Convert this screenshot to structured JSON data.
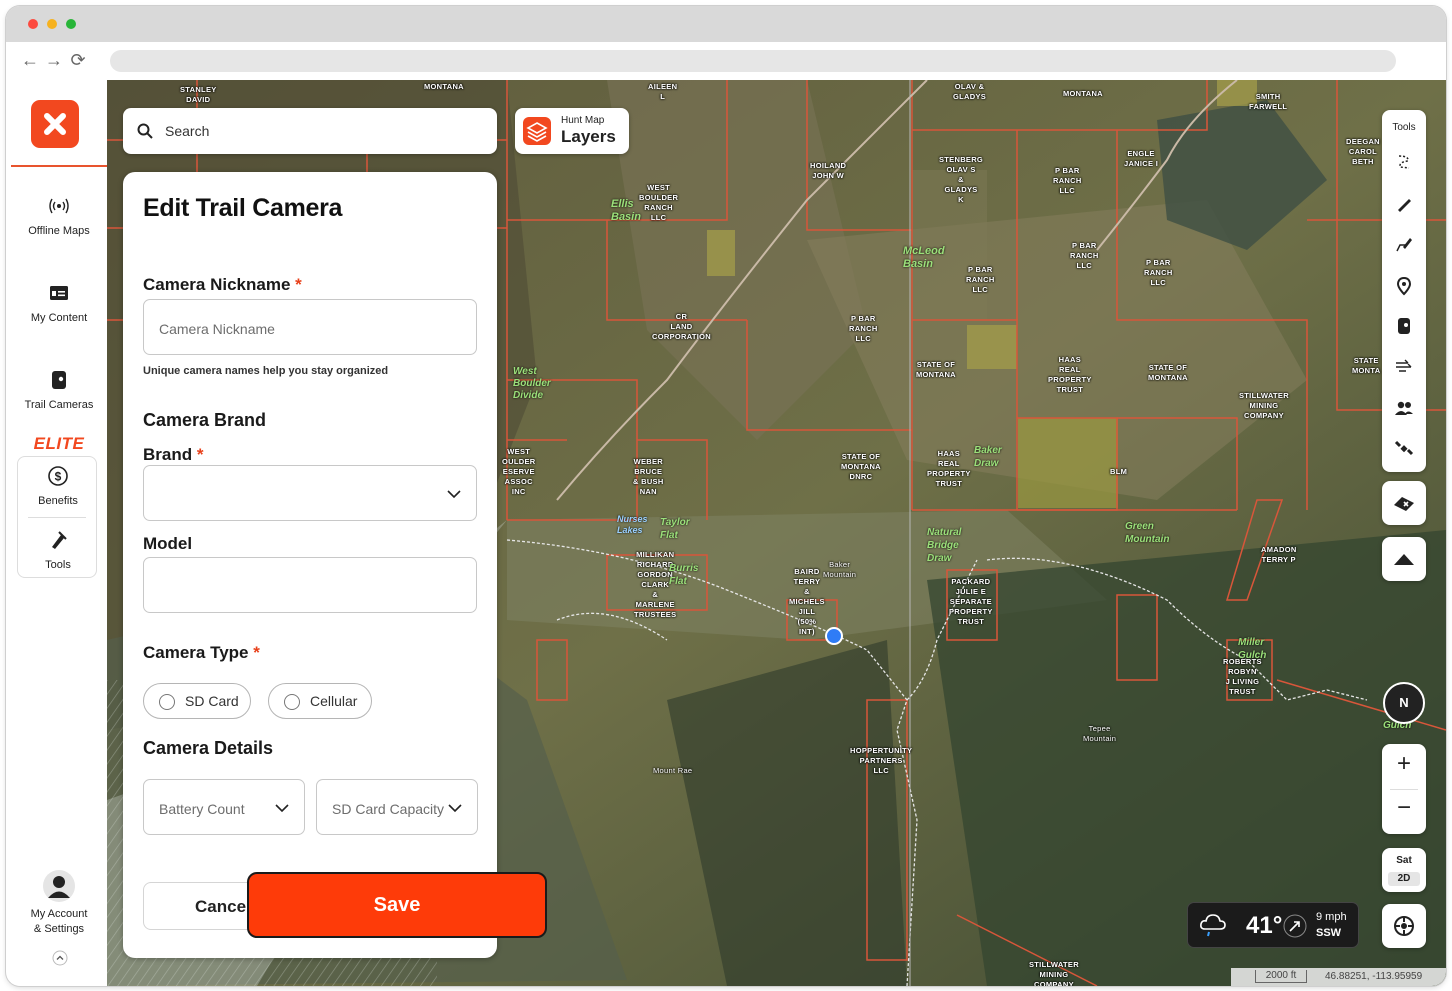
{
  "browser": {
    "back": "←",
    "forward": "→",
    "reload": "⟳"
  },
  "sidebar": {
    "items": [
      {
        "label": "Offline Maps",
        "icon": "offline-maps-icon"
      },
      {
        "label": "My Content",
        "icon": "my-content-icon"
      },
      {
        "label": "Trail Cameras",
        "icon": "trail-camera-icon"
      }
    ],
    "elite": "ELITE",
    "elite_items": [
      {
        "label": "Benefits",
        "icon": "dollar-icon"
      },
      {
        "label": "Tools",
        "icon": "tools-icon"
      }
    ],
    "account_line1": "My Account",
    "account_line2": "& Settings"
  },
  "search": {
    "placeholder": "Search"
  },
  "layers": {
    "small": "Hunt Map",
    "large": "Layers"
  },
  "form": {
    "title": "Edit Trail Camera",
    "nickname_label": "Camera Nickname",
    "required_mark": "*",
    "nickname_placeholder": "Camera Nickname",
    "nickname_hint": "Unique camera names help you stay organized",
    "brand_section": "Camera Brand",
    "brand_label": "Brand",
    "model_label": "Model",
    "type_label": "Camera Type",
    "type_options": [
      "SD Card",
      "Cellular"
    ],
    "details_section": "Camera Details",
    "battery_placeholder": "Battery Count",
    "sd_capacity_placeholder": "SD Card Capacity",
    "cancel": "Cancel",
    "save": "Save"
  },
  "tools": {
    "title": "Tools"
  },
  "compass": "N",
  "zoom": {
    "in": "+",
    "out": "−"
  },
  "basemap": {
    "type": "Sat",
    "mode": "2D"
  },
  "weather": {
    "temp": "41°",
    "speed": "9 mph",
    "direction": "SSW"
  },
  "scale": {
    "distance": "2000 ft",
    "coords": "46.88251, -113.95959"
  },
  "map_labels": [
    {
      "t": "STANLEY\nDAVID"
    },
    {
      "t": "MONTANA"
    },
    {
      "t": "AILEEN\nL"
    },
    {
      "t": "OLAV &\nGLADYS"
    },
    {
      "t": "MONTANA"
    },
    {
      "t": "SMITH\nFARWELL"
    },
    {
      "t": "HOILAND\nJOHN W"
    },
    {
      "t": "STENBERG\nOLAV S\n&\nGLADYS\nK"
    },
    {
      "t": "P BAR\nRANCH\nLLC"
    },
    {
      "t": "ENGLE\nJANICE I"
    },
    {
      "t": "DEEGAN\nCAROL\nBETH"
    },
    {
      "t": "WEST\nBOULDER\nRANCH\nLLC"
    },
    {
      "t": "P BAR\nRANCH\nLLC"
    },
    {
      "t": "P BAR\nRANCH\nLLC"
    },
    {
      "t": "P BAR\nRANCH\nLLC"
    },
    {
      "t": "CR\nLAND\nCORPORATION"
    },
    {
      "t": "P BAR\nRANCH\nLLC"
    },
    {
      "t": "STATE OF\nMONTANA"
    },
    {
      "t": "HAAS\nREAL\nPROPERTY\nTRUST"
    },
    {
      "t": "STATE OF\nMONTANA"
    },
    {
      "t": "STILLWATER\nMINING\nCOMPANY"
    },
    {
      "t": "STATE\nMONTA"
    },
    {
      "t": "WEST\nOULDER\nESERVE\nASSOC\nINC"
    },
    {
      "t": "WEBER\nBRUCE\n& BUSH\nNAN"
    },
    {
      "t": "STATE OF\nMONTANA\nDNRC"
    },
    {
      "t": "HAAS\nREAL\nPROPERTY\nTRUST"
    },
    {
      "t": "BLM"
    },
    {
      "t": "AMADON\nTERRY P"
    },
    {
      "t": "MILLIKAN\nRICHARD\nGORDON\nCLARK\n&\nMARLENE\nTRUSTEES"
    },
    {
      "t": "BAIRD\nTERRY\n&\nMICHELS\nJILL\n(50%\nINT)"
    },
    {
      "t": "PACKARD\nJULIE E\nSEPARATE\nPROPERTY\nTRUST"
    },
    {
      "t": "ROBERTS\nROBYN\nJ LIVING\nTRUST"
    },
    {
      "t": "HOPPERTUNITY\nPARTNERS\nLLC"
    },
    {
      "t": "STILLWATER\nMINING\nCOMPANY"
    },
    {
      "t": "Baker\nMountain"
    },
    {
      "t": "Tepee\nMountain"
    },
    {
      "t": "Mount Rae"
    }
  ],
  "map_green_labels": [
    {
      "t": "Ellis\nBasin"
    },
    {
      "t": "McLeod\nBasin"
    },
    {
      "t": "West\nBoulder\nDivide"
    },
    {
      "t": "Taylor\nFlat"
    },
    {
      "t": "Nurses\nLakes"
    },
    {
      "t": "Burris\nFlat"
    },
    {
      "t": "Baker\nDraw"
    },
    {
      "t": "Green\nMountain"
    },
    {
      "t": "Natural\nBridge\nDraw"
    },
    {
      "t": "Miller\nGulch"
    },
    {
      "t": "Gulch"
    }
  ]
}
